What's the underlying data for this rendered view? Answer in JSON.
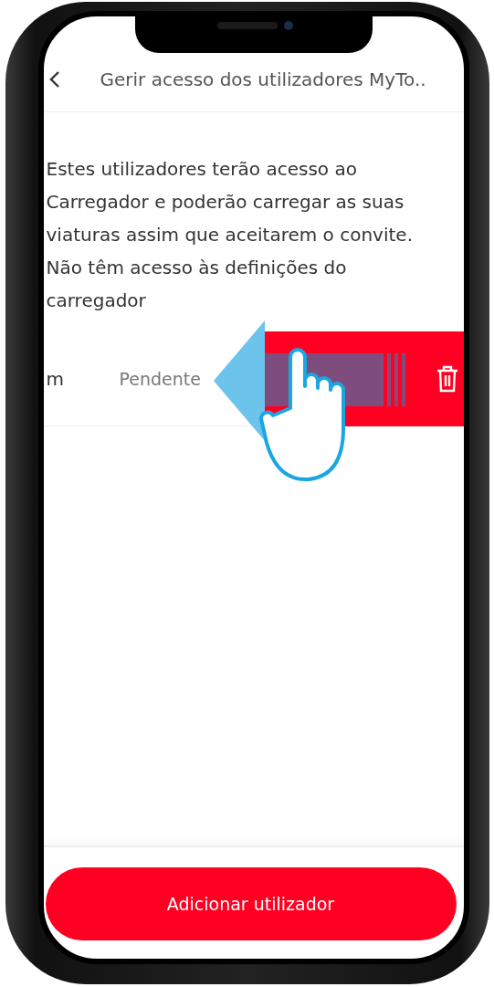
{
  "header": {
    "title": "Gerir acesso dos utilizadores MyTo.."
  },
  "description": "Estes utilizadores terão acesso ao Carregador e poderão carregar as suas viaturas assim que aceitarem o convite. Não têm acesso às definições do carregador",
  "users": [
    {
      "name": "m",
      "status": "Pendente",
      "swiped": true
    }
  ],
  "add_button": {
    "label": "Adicionar utilizador"
  }
}
